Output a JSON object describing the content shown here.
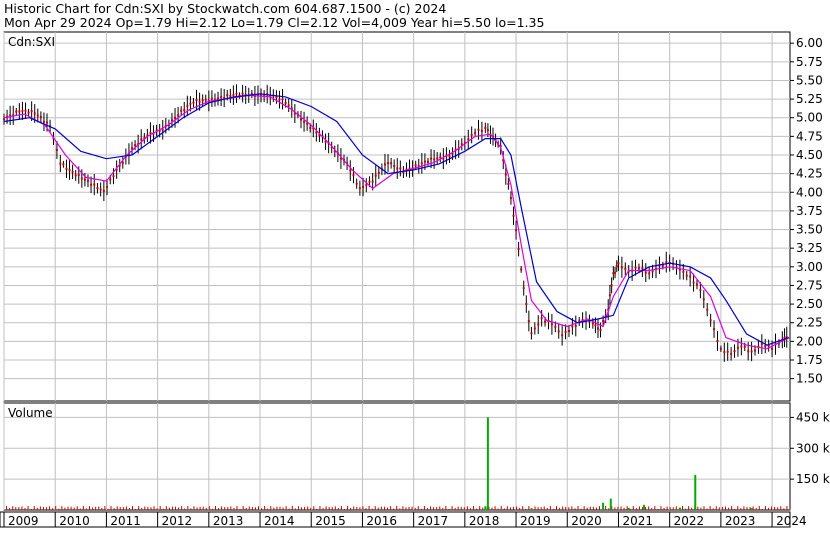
{
  "header": {
    "line1": "Historic Chart for Cdn:SXI by Stockwatch.com 604.687.1500 - (c) 2024",
    "line2": "Mon Apr 29 2024  Op=1.79  Hi=2.12  Lo=1.79  Cl=2.12  Vol=4,009  Year hi=5.50  lo=1.35"
  },
  "colors": {
    "price_bar": "#000000",
    "price_dot": "#cc0000",
    "ma_short": "#e000e0",
    "ma_long": "#0000cc",
    "volume_bar": "#00aa00",
    "volume_small": "#cc0000",
    "grid": "#c0c0c0"
  },
  "chart_data": [
    {
      "type": "line",
      "panel_label": "Cdn:SXI",
      "y_ticks": [
        "6.00",
        "5.75",
        "5.50",
        "5.25",
        "5.00",
        "4.75",
        "4.50",
        "4.25",
        "4.00",
        "3.75",
        "3.50",
        "3.25",
        "3.00",
        "2.75",
        "2.50",
        "2.25",
        "2.00",
        "1.75",
        "1.50"
      ],
      "ylim": [
        1.2,
        6.15
      ],
      "x_ticks": [
        "2009",
        "2010",
        "2011",
        "2012",
        "2013",
        "2014",
        "2015",
        "2016",
        "2017",
        "2018",
        "2019",
        "2020",
        "2021",
        "2022",
        "2023",
        "2024"
      ],
      "xlim": [
        2009.0,
        2024.35
      ],
      "series": [
        {
          "style": "price",
          "x": [
            2009.0,
            2009.3,
            2009.6,
            2009.9,
            2010.1,
            2010.4,
            2010.7,
            2010.95,
            2011.2,
            2011.5,
            2011.8,
            2012.1,
            2012.4,
            2012.7,
            2013.0,
            2013.3,
            2013.6,
            2013.9,
            2014.2,
            2014.5,
            2014.8,
            2015.1,
            2015.4,
            2015.7,
            2015.95,
            2016.2,
            2016.5,
            2016.8,
            2017.1,
            2017.4,
            2017.7,
            2018.0,
            2018.2,
            2018.4,
            2018.55,
            2018.7,
            2018.85,
            2019.0,
            2019.15,
            2019.3,
            2019.5,
            2019.7,
            2019.9,
            2020.1,
            2020.3,
            2020.5,
            2020.65,
            2020.8,
            2020.9,
            2021.0,
            2021.2,
            2021.4,
            2021.6,
            2021.8,
            2022.0,
            2022.2,
            2022.4,
            2022.6,
            2022.8,
            2023.0,
            2023.2,
            2023.4,
            2023.6,
            2023.8,
            2024.0,
            2024.2,
            2024.33
          ],
          "y": [
            5.0,
            5.1,
            5.05,
            4.9,
            4.4,
            4.25,
            4.1,
            4.0,
            4.3,
            4.6,
            4.75,
            4.85,
            5.05,
            5.2,
            5.25,
            5.28,
            5.3,
            5.32,
            5.3,
            5.2,
            5.0,
            4.8,
            4.6,
            4.4,
            4.05,
            4.15,
            4.4,
            4.3,
            4.35,
            4.45,
            4.5,
            4.65,
            4.8,
            4.85,
            4.75,
            4.6,
            4.1,
            3.5,
            2.7,
            2.1,
            2.3,
            2.25,
            2.1,
            2.2,
            2.3,
            2.25,
            2.15,
            2.45,
            2.9,
            3.05,
            2.95,
            3.0,
            2.9,
            3.0,
            3.05,
            2.95,
            2.85,
            2.7,
            2.3,
            1.9,
            1.85,
            1.95,
            1.85,
            1.95,
            1.9,
            2.0,
            2.12
          ]
        },
        {
          "style": "ma_short",
          "x": [
            2009.0,
            2009.4,
            2009.8,
            2010.2,
            2010.6,
            2011.0,
            2011.4,
            2011.8,
            2012.2,
            2012.6,
            2013.0,
            2013.4,
            2013.8,
            2014.2,
            2014.6,
            2015.0,
            2015.4,
            2015.8,
            2016.2,
            2016.6,
            2017.0,
            2017.4,
            2017.8,
            2018.2,
            2018.5,
            2018.7,
            2018.9,
            2019.1,
            2019.3,
            2019.6,
            2020.0,
            2020.4,
            2020.7,
            2020.9,
            2021.2,
            2021.6,
            2022.0,
            2022.4,
            2022.8,
            2023.1,
            2023.5,
            2023.9,
            2024.33
          ],
          "y": [
            5.0,
            5.05,
            4.9,
            4.5,
            4.2,
            4.15,
            4.5,
            4.75,
            4.9,
            5.1,
            5.22,
            5.26,
            5.3,
            5.28,
            5.12,
            4.9,
            4.62,
            4.3,
            4.05,
            4.25,
            4.32,
            4.4,
            4.55,
            4.75,
            4.78,
            4.6,
            4.1,
            3.3,
            2.55,
            2.28,
            2.2,
            2.3,
            2.2,
            2.6,
            2.95,
            2.95,
            3.0,
            2.95,
            2.6,
            2.05,
            1.95,
            1.9,
            2.05
          ]
        },
        {
          "style": "ma_long",
          "x": [
            2009.0,
            2009.5,
            2010.0,
            2010.5,
            2011.0,
            2011.5,
            2012.0,
            2012.5,
            2013.0,
            2013.5,
            2014.0,
            2014.5,
            2015.0,
            2015.5,
            2016.0,
            2016.5,
            2017.0,
            2017.5,
            2018.0,
            2018.4,
            2018.7,
            2018.9,
            2019.1,
            2019.4,
            2019.8,
            2020.2,
            2020.6,
            2020.9,
            2021.2,
            2021.6,
            2022.0,
            2022.4,
            2022.8,
            2023.1,
            2023.5,
            2023.9,
            2024.33
          ],
          "y": [
            4.95,
            5.0,
            4.85,
            4.55,
            4.45,
            4.5,
            4.75,
            5.0,
            5.2,
            5.28,
            5.32,
            5.28,
            5.15,
            4.95,
            4.5,
            4.25,
            4.3,
            4.38,
            4.55,
            4.72,
            4.72,
            4.5,
            3.8,
            2.8,
            2.4,
            2.25,
            2.3,
            2.35,
            2.85,
            3.0,
            3.05,
            3.0,
            2.85,
            2.55,
            2.1,
            1.95,
            2.05
          ]
        }
      ]
    },
    {
      "type": "bar",
      "panel_label": "Volume",
      "y_ticks": [
        "450 k",
        "300 k",
        "150 k"
      ],
      "ylim": [
        0,
        520000
      ],
      "x_ticks": [
        "2009",
        "2010",
        "2011",
        "2012",
        "2013",
        "2014",
        "2015",
        "2016",
        "2017",
        "2018",
        "2019",
        "2020",
        "2021",
        "2022",
        "2023",
        "2024"
      ],
      "bars": {
        "x": [
          2018.45,
          2020.7,
          2020.85,
          2021.5,
          2022.5,
          2022.2,
          2018.4,
          2019.3,
          2021.2,
          2023.6
        ],
        "values": [
          450000,
          35000,
          55000,
          25000,
          170000,
          12000,
          18000,
          8000,
          10000,
          9000
        ]
      }
    }
  ]
}
